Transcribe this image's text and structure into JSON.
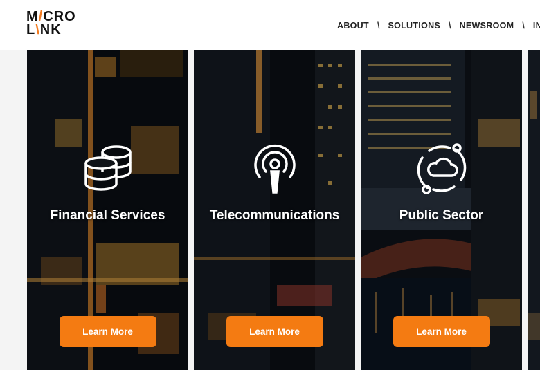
{
  "brand": {
    "line1_a": "M",
    "line1_b": "CRO",
    "line2_a": "L",
    "line2_b": "NK",
    "accent": "#f47b20"
  },
  "nav": {
    "items": [
      "ABOUT",
      "SOLUTIONS",
      "NEWSROOM",
      "INVE"
    ],
    "separator": "\\"
  },
  "cards": [
    {
      "title": "Financial Services",
      "button": "Learn More",
      "icon": "database-icon"
    },
    {
      "title": "Telecommunications",
      "button": "Learn More",
      "icon": "podcast-icon"
    },
    {
      "title": "Public Sector",
      "button": "Learn More",
      "icon": "cloud-network-icon"
    },
    {
      "title": "",
      "button": "",
      "icon": ""
    }
  ],
  "colors": {
    "button": "#f47b12",
    "header_bg": "#ffffff",
    "card_bg": "#0d1116"
  }
}
